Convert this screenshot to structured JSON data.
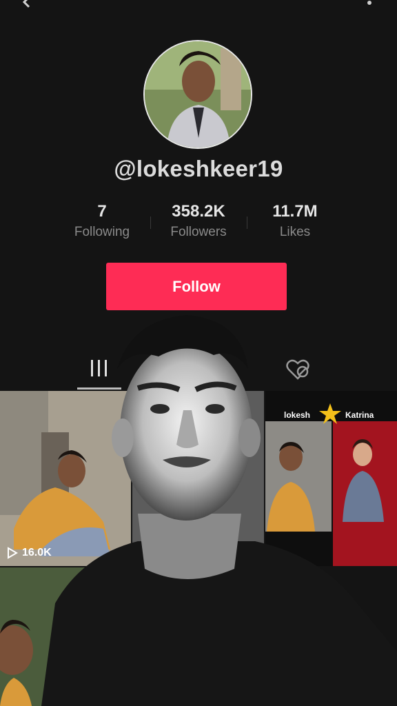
{
  "header": {
    "back_icon": "chevron-left-icon",
    "more_icon": "more-vertical-icon"
  },
  "profile": {
    "username": "@lokeshkeer19",
    "avatar_icon": "avatar-photo"
  },
  "stats": [
    {
      "value": "7",
      "label": "Following"
    },
    {
      "value": "358.2K",
      "label": "Followers"
    },
    {
      "value": "11.7M",
      "label": "Likes"
    }
  ],
  "actions": {
    "follow_label": "Follow"
  },
  "tabs": {
    "videos_icon": "grid-bars-icon",
    "liked_icon": "hidden-heart-icon"
  },
  "videos": [
    {
      "play_count": "16.0K"
    },
    {
      "left_name": "lokesh",
      "right_name": "Katrina"
    }
  ],
  "colors": {
    "background": "#141414",
    "follow_button": "#fe2c55",
    "username_text": "#dcdcdc",
    "secondary_text": "#8a8a8a"
  }
}
